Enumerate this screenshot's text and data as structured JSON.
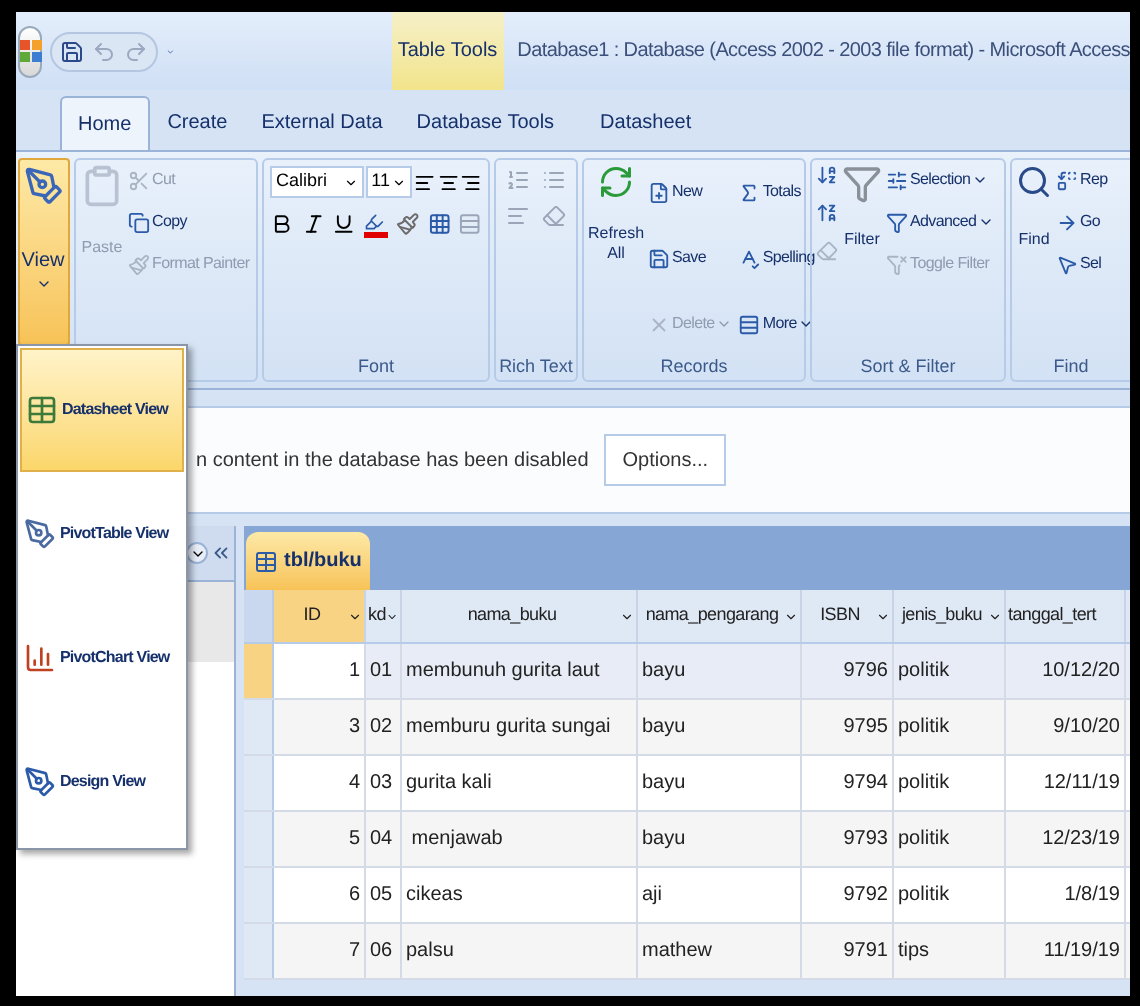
{
  "title_bar": {
    "contextual_tab": "Table Tools",
    "title": "Database1 : Database (Access 2002 - 2003 file format) - Microsoft Access"
  },
  "ribbon_tabs": [
    {
      "label": "Home",
      "selected": true
    },
    {
      "label": "Create",
      "selected": false
    },
    {
      "label": "External Data",
      "selected": false
    },
    {
      "label": "Database Tools",
      "selected": false
    },
    {
      "label": "Datasheet",
      "selected": false
    }
  ],
  "ribbon": {
    "view_button": {
      "label": "View"
    },
    "clipboard": {
      "paste": {
        "label": "Paste",
        "disabled": true
      },
      "items": [
        {
          "label": "Cut",
          "disabled": true
        },
        {
          "label": "Copy",
          "disabled": false
        },
        {
          "label": "Format Painter",
          "disabled": true
        }
      ]
    },
    "font": {
      "label": "Font",
      "font_name": "Calibri",
      "font_size": "11"
    },
    "rich_text": {
      "label": "Rich Text"
    },
    "records": {
      "label": "Records",
      "refresh": {
        "label": "Refresh All"
      },
      "items": [
        {
          "label": "New",
          "disabled": false
        },
        {
          "label": "Save",
          "disabled": false
        },
        {
          "label": "Delete",
          "disabled": true
        },
        {
          "label": "Totals",
          "disabled": false
        },
        {
          "label": "Spelling",
          "disabled": false
        },
        {
          "label": "More",
          "disabled": false
        }
      ]
    },
    "sort_filter": {
      "label": "Sort & Filter",
      "filter": {
        "label": "Filter"
      },
      "items": [
        {
          "label": "Selection",
          "disabled": false
        },
        {
          "label": "Advanced",
          "disabled": false
        },
        {
          "label": "Toggle Filter",
          "disabled": true
        }
      ]
    },
    "find": {
      "label": "Find",
      "find_button": {
        "label": "Find"
      },
      "items": [
        {
          "label": "Rep"
        },
        {
          "label": "Go"
        },
        {
          "label": "Sel"
        }
      ]
    }
  },
  "message_bar": {
    "text": "n content in the database has been disabled",
    "button": "Options..."
  },
  "view_menu": [
    {
      "label": "Datasheet View",
      "selected": true
    },
    {
      "label": "PivotTable View",
      "selected": false
    },
    {
      "label": "PivotChart View",
      "selected": false
    },
    {
      "label": "Design View",
      "selected": false
    }
  ],
  "table": {
    "tab": "tbl/buku",
    "columns": [
      "ID",
      "kd",
      "nama_buku",
      "nama_pengarang",
      "ISBN",
      "jenis_buku",
      "tanggal_tert"
    ],
    "rows": [
      {
        "selected": true,
        "cells": [
          "1",
          "01",
          "membunuh gurita laut",
          "bayu",
          "9796",
          "politik",
          "10/12/20"
        ]
      },
      {
        "selected": false,
        "cells": [
          "3",
          "02",
          "memburu gurita sungai",
          "bayu",
          "9795",
          "politik",
          "9/10/20"
        ]
      },
      {
        "selected": false,
        "cells": [
          "4",
          "03",
          "gurita kali",
          "bayu",
          "9794",
          "politik",
          "12/11/19"
        ]
      },
      {
        "selected": false,
        "cells": [
          "5",
          "04",
          " menjawab",
          "bayu",
          "9793",
          "politik",
          "12/23/19"
        ]
      },
      {
        "selected": false,
        "cells": [
          "6",
          "05",
          "cikeas",
          "aji",
          "9792",
          "politik",
          "1/8/19"
        ]
      },
      {
        "selected": false,
        "cells": [
          "7",
          "06",
          "palsu",
          "mathew",
          "9791",
          "tips",
          "11/19/19"
        ]
      }
    ]
  }
}
